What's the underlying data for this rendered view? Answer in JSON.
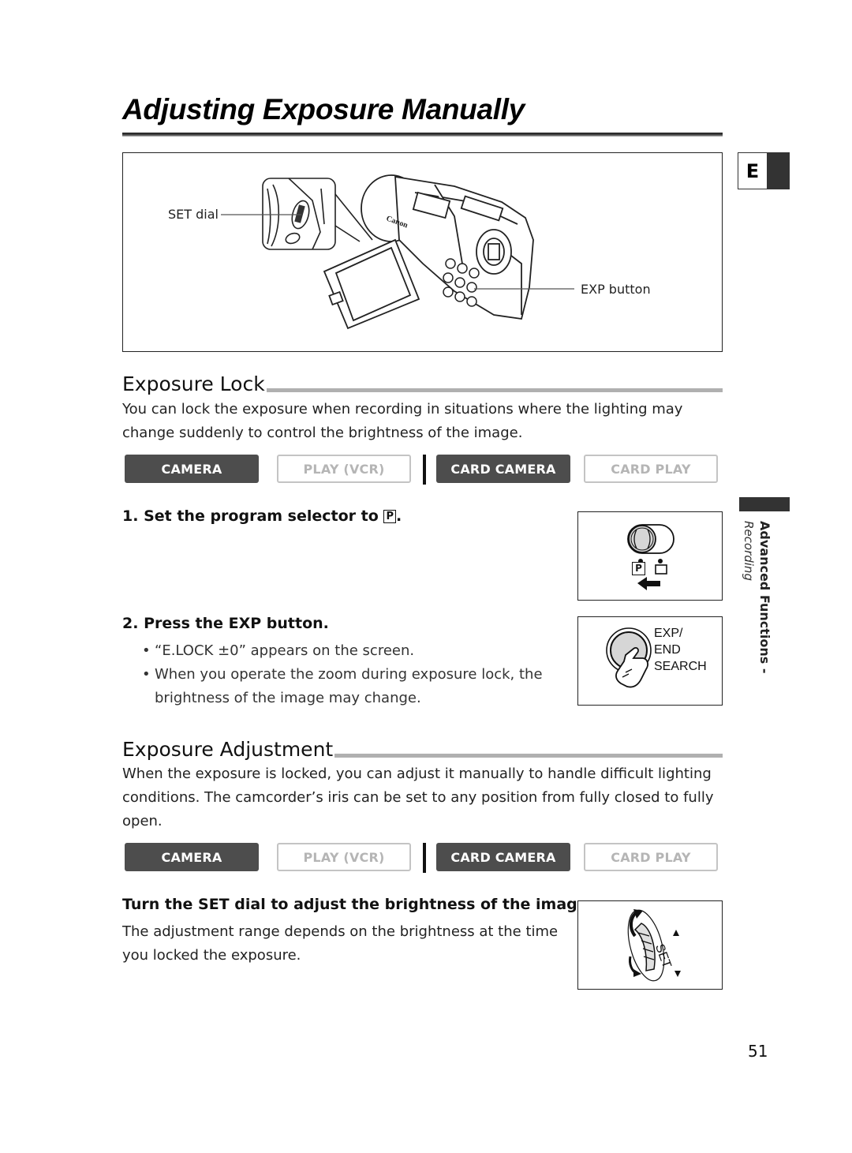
{
  "page": {
    "title": "Adjusting Exposure Manually",
    "language_tab": "E",
    "side_section": {
      "main": "Advanced Functions -",
      "sub": "Recording"
    },
    "page_number": "51"
  },
  "figure": {
    "labels": {
      "set_dial": "SET dial",
      "exp_button": "EXP button"
    },
    "brand_text": "Canon"
  },
  "exposure_lock": {
    "heading": "Exposure Lock",
    "intro": "You can lock the exposure when recording in situations where the lighting may change suddenly to control the brightness of the image.",
    "modes": [
      {
        "label": "CAMERA",
        "active": true
      },
      {
        "label": "PLAY (VCR)",
        "active": false
      },
      {
        "label": "CARD CAMERA",
        "active": true
      },
      {
        "label": "CARD PLAY",
        "active": false
      }
    ],
    "steps": [
      {
        "number": "1.",
        "text": "Set the program selector to",
        "symbol": "P",
        "suffix": "."
      },
      {
        "number": "2.",
        "text": "Press the EXP button.",
        "bullets": [
          "“E.LOCK ±0” appears on the screen.",
          "When you operate the zoom during exposure lock, the brightness of the image may change."
        ]
      }
    ],
    "selector_illustration": {
      "positions": [
        "P",
        "□"
      ]
    },
    "button_illustration": {
      "label_lines": [
        "EXP/",
        "END",
        "SEARCH"
      ]
    }
  },
  "exposure_adjustment": {
    "heading": "Exposure Adjustment",
    "intro": "When the exposure is locked, you can adjust it manually to handle difficult lighting conditions. The camcorder’s iris can be set to any position from fully closed to fully open.",
    "modes": [
      {
        "label": "CAMERA",
        "active": true
      },
      {
        "label": "PLAY (VCR)",
        "active": false
      },
      {
        "label": "CARD CAMERA",
        "active": true
      },
      {
        "label": "CARD PLAY",
        "active": false
      }
    ],
    "instruction": "Turn the SET dial to adjust the brightness of the image.",
    "note": "The adjustment range depends on the brightness at the time you locked the exposure.",
    "dial_illustration": {
      "label": "SET"
    }
  }
}
